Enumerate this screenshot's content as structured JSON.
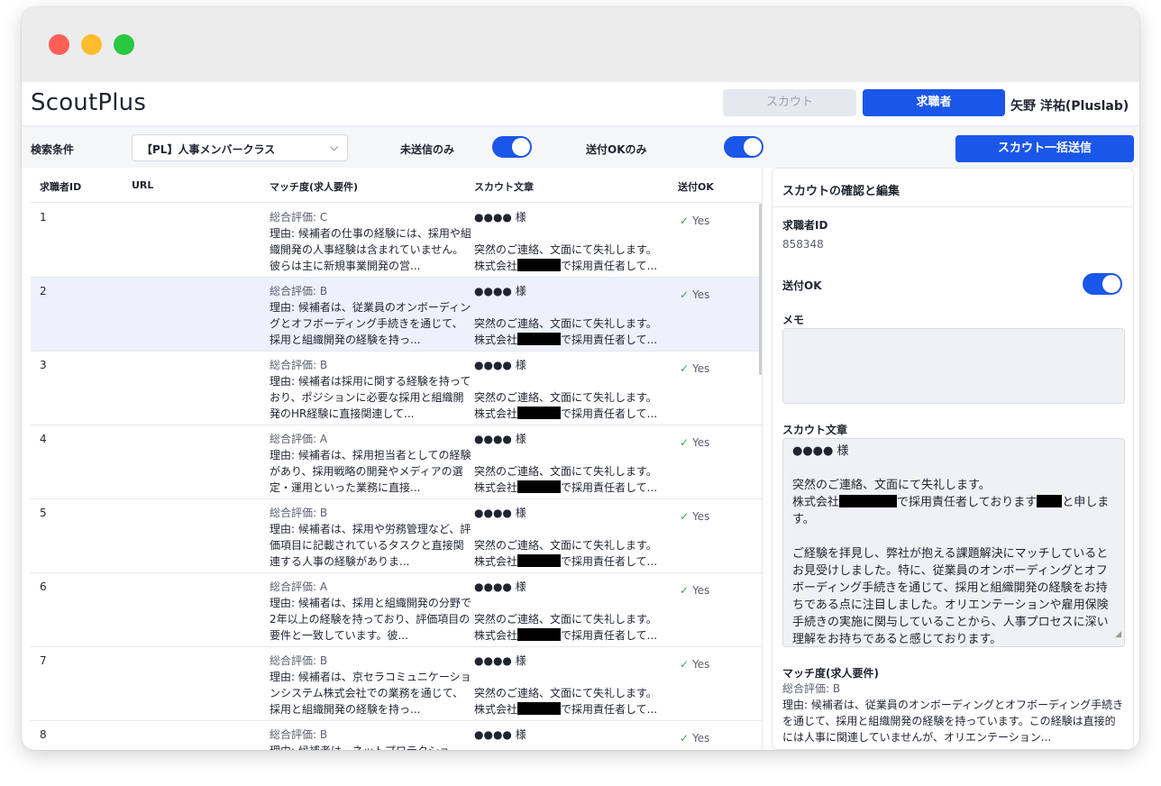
{
  "app": {
    "title": "ScoutPlus",
    "user_name": "矢野 洋祐(Pluslab)"
  },
  "nav": {
    "scout_tab": "スカウト",
    "seeker_tab": "求職者"
  },
  "filters": {
    "search_label": "検索条件",
    "search_value": "【PL】人事メンバークラス",
    "unsent_only_label": "未送信のみ",
    "unsent_only_on": true,
    "ok_only_label": "送付OKのみ",
    "ok_only_on": true,
    "bulk_send_label": "スカウト一括送信"
  },
  "table": {
    "headers": {
      "id": "求職者ID",
      "url": "URL",
      "match": "マッチ度(求人要件)",
      "scout": "スカウト文章",
      "ok": "送付OK"
    },
    "scout_line1": "●●●● 様",
    "scout_line2": "突然のご連絡、文面にて失礼します。",
    "scout_line3_prefix": "株式会社",
    "scout_line3_suffix": "で採用責任者して...",
    "ok_text": "Yes",
    "rows": [
      {
        "id": "1",
        "grade": "総合評価: C",
        "reason": "理由: 候補者の仕事の経験には、採用や組織開発の人事経験は含まれていません。彼らは主に新規事業開発の営..."
      },
      {
        "id": "2",
        "grade": "総合評価: B",
        "reason": "理由: 候補者は、従業員のオンボーディングとオフボーディング手続きを通じて、採用と組織開発の経験を持っ..."
      },
      {
        "id": "3",
        "grade": "総合評価: B",
        "reason": "理由: 候補者は採用に関する経験を持っており、ポジションに必要な採用と組織開発のHR経験に直接関連して..."
      },
      {
        "id": "4",
        "grade": "総合評価: A",
        "reason": "理由: 候補者は、採用担当者としての経験があり、採用戦略の開発やメディアの選定・運用といった業務に直接..."
      },
      {
        "id": "5",
        "grade": "総合評価: B",
        "reason": "理由: 候補者は、採用や労務管理など、評価項目に記載されているタスクと直接関連する人事の経験がありま..."
      },
      {
        "id": "6",
        "grade": "総合評価: A",
        "reason": "理由: 候補者は、採用と組織開発の分野で2年以上の経験を持っており、評価項目の要件と一致しています。彼..."
      },
      {
        "id": "7",
        "grade": "総合評価: B",
        "reason": "理由: 候補者は、京セラコミュニケーションシステム株式会社での業務を通じて、採用と組織開発の経験を持っ..."
      },
      {
        "id": "8",
        "grade": "総合評価: B",
        "reason": "理由: 候補者は、ネットプロテクショ"
      }
    ]
  },
  "detail": {
    "title": "スカウトの確認と編集",
    "seeker_id_label": "求職者ID",
    "seeker_id": "858348",
    "ok_label": "送付OK",
    "ok_on": true,
    "memo_label": "メモ",
    "memo_value": "",
    "scout_label": "スカウト文章",
    "scout_greeting": "●●●● 様",
    "scout_p1": "突然のご連絡、文面にて失礼します。",
    "scout_p2_prefix": "株式会社",
    "scout_p2_mid": "で採用責任者しております",
    "scout_p2_suffix": "と申します。",
    "scout_p3": "ご経験を拝見し、弊社が抱える課題解決にマッチしているとお見受けしました。特に、従業員のオンボーディングとオフボーディング手続きを通じて、採用と組織開発の経験をお持ちである点に注目しました。オリエンテーションや雇用保険手続きの実施に関与していることから、人事プロセスに深い理解をお持ちであると感じております。",
    "match_label": "マッチ度(求人要件)",
    "match_grade": "総合評価: B",
    "match_reason": "理由: 候補者は、従業員のオンボーディングとオフボーディング手続きを通じて、採用と組織開発の経験を持っています。この経験は直接的には人事に関連していませんが、オリエンテーション..."
  },
  "colors": {
    "primary": "#1a56e8",
    "selected_row": "#eef1fb",
    "check": "#3aa55d"
  }
}
